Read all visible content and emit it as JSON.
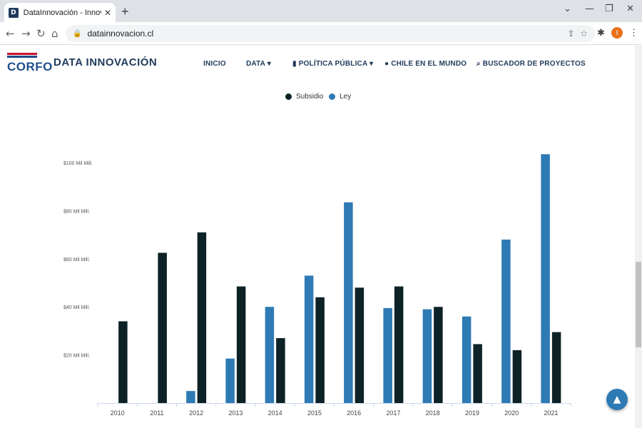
{
  "browser": {
    "tab_title": "DataInnovación - InnovaChile Co",
    "favicon_letter": "D",
    "url": "datainnovacion.cl",
    "profile_initial": "I"
  },
  "site": {
    "logo_text": "CORFO",
    "brand": "DATA INNOVACIÓN",
    "nav": [
      {
        "label": "INICIO"
      },
      {
        "label": "DATA ▾"
      },
      {
        "label": "POLÍTICA PÚBLICA ▾"
      },
      {
        "label": "CHILE EN EL MUNDO"
      },
      {
        "label": "BUSCADOR DE PROYECTOS"
      }
    ],
    "icons": {
      "bookmark": "bookmark-icon",
      "globe": "globe-icon",
      "search": "search-icon"
    }
  },
  "chart_data": {
    "type": "bar",
    "categories": [
      "2010",
      "2011",
      "2012",
      "2013",
      "2014",
      "2015",
      "2016",
      "2017",
      "2018",
      "2019",
      "2020",
      "2021"
    ],
    "series": [
      {
        "name": "Ley",
        "color": "#2e7ab5",
        "values": [
          0,
          0,
          5,
          18.5,
          40,
          53,
          83.5,
          39.5,
          39,
          36,
          68,
          103.5
        ]
      },
      {
        "name": "Subsidio",
        "color": "#0d2226",
        "values": [
          34,
          62.5,
          71,
          48.5,
          27,
          44,
          48,
          48.5,
          40,
          24.5,
          22,
          29.5
        ]
      }
    ],
    "legend": [
      "Subsidio",
      "Ley"
    ],
    "legend_colors": [
      "#0d2226",
      "#2e7ab5"
    ],
    "yticks": [
      20,
      40,
      60,
      80,
      100
    ],
    "ytick_labels": [
      "$20 Mil Mill.",
      "$40 Mil Mill.",
      "$60 Mil Mill.",
      "$80 Mil Mill.",
      "$100 Mil Mill."
    ],
    "ylim": [
      0,
      105
    ],
    "grid": false,
    "legend_position": "top-center"
  }
}
